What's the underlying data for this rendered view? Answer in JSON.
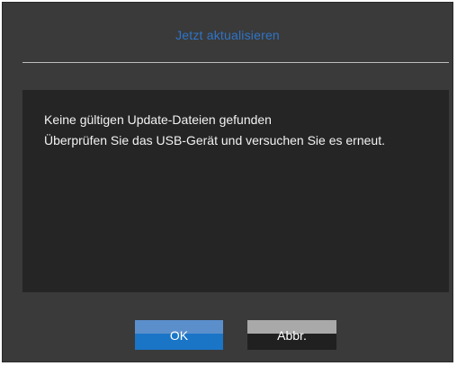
{
  "dialog": {
    "title": "Jetzt aktualisieren",
    "message_lines": [
      "Keine gültigen Update-Dateien gefunden",
      "Überprüfen Sie das USB-Gerät und versuchen Sie es erneut."
    ],
    "buttons": {
      "ok_label": "OK",
      "cancel_label": "Abbr."
    }
  },
  "colors": {
    "title": "#2f74c7",
    "dialog_background": "#3a3a3a",
    "message_panel": "#252525",
    "ok_button": "#1a75c7",
    "cancel_button": "#202020"
  }
}
